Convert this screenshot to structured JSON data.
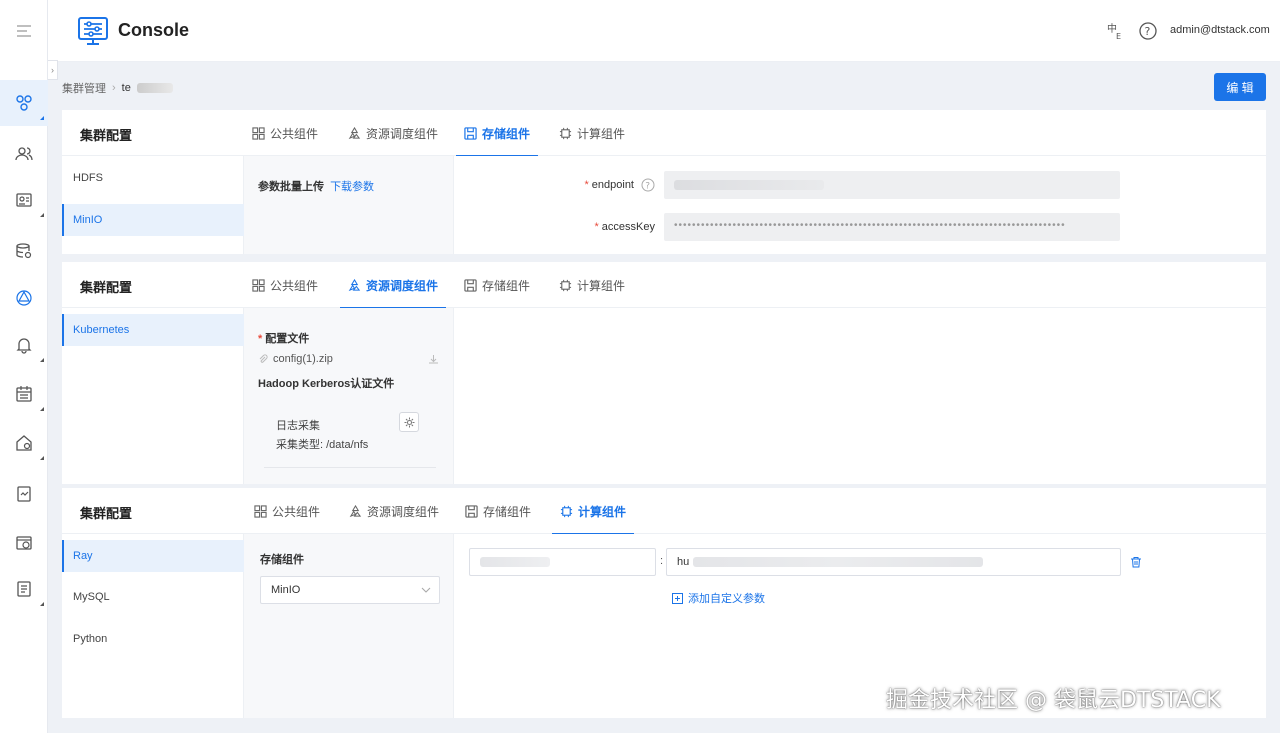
{
  "header": {
    "title": "Console",
    "user": "admin@dtstack.com"
  },
  "breadcrumb": {
    "root": "集群管理",
    "current": "te"
  },
  "edit_label": "编 辑",
  "tabs": [
    "公共组件",
    "资源调度组件",
    "存储组件",
    "计算组件"
  ],
  "panel_title": "集群配置",
  "storage_panel": {
    "list": [
      "HDFS",
      "MinIO"
    ],
    "active_item": "MinIO",
    "upload_label": "参数批量上传",
    "download_link": "下载参数",
    "fields": [
      {
        "label": "endpoint"
      },
      {
        "label": "accessKey",
        "mask": "•••••••••••••••••••••••••••••••••••••••••••••••••••••••••••••••••••••••••••••••••••••••"
      }
    ]
  },
  "resource_panel": {
    "list": [
      "Kubernetes"
    ],
    "config_label": "配置文件",
    "file_name": "config(1).zip",
    "kerberos_label": "Hadoop Kerberos认证文件",
    "log_label": "日志采集",
    "collect_type": "采集类型: /data/nfs"
  },
  "compute_panel": {
    "list": [
      "Ray",
      "MySQL",
      "Python"
    ],
    "active_item": "Ray",
    "storage_label": "存储组件",
    "storage_value": "MinIO",
    "param_value_prefix": "hu",
    "colon": ":",
    "add_param": "添加自定义参数"
  },
  "watermark": "掘金技术社区 @ 袋鼠云DTSTACK",
  "colors": {
    "accent": "#1b74e8",
    "required": "#e84b3c"
  }
}
